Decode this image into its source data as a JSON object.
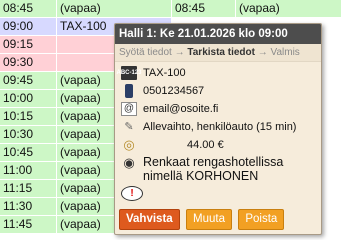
{
  "schedule": {
    "left_rows": [
      {
        "time": "08:45",
        "label": "(vapaa)",
        "status": "free"
      },
      {
        "time": "09:00",
        "label": "TAX-100",
        "status": "booked"
      },
      {
        "time": "09:15",
        "label": "",
        "status": "empty"
      },
      {
        "time": "09:30",
        "label": "",
        "status": "empty"
      },
      {
        "time": "09:45",
        "label": "(vapaa)",
        "status": "free"
      },
      {
        "time": "10:00",
        "label": "(vapaa)",
        "status": "free"
      },
      {
        "time": "10:15",
        "label": "(vapaa)",
        "status": "free"
      },
      {
        "time": "10:30",
        "label": "(vapaa)",
        "status": "free"
      },
      {
        "time": "10:45",
        "label": "(vapaa)",
        "status": "free"
      },
      {
        "time": "11:00",
        "label": "(vapaa)",
        "status": "free"
      },
      {
        "time": "11:15",
        "label": "(vapaa)",
        "status": "free"
      },
      {
        "time": "11:30",
        "label": "(vapaa)",
        "status": "free"
      },
      {
        "time": "11:45",
        "label": "(vapaa)",
        "status": "free"
      }
    ],
    "right_top": {
      "time": "08:45",
      "label": "(vapaa)",
      "status": "free"
    }
  },
  "popup": {
    "title": "Halli 1: Ke 21.01.2026 klo 09:00",
    "steps": {
      "step1": "Syötä tiedot",
      "arrow1": "→",
      "step2": "Tarkista tiedot",
      "arrow2": "→",
      "step3": "Valmis"
    },
    "registration": "TAX-100",
    "registration_icon": "ABC-123",
    "phone": "0501234567",
    "email": "email@osoite.fi",
    "service": "Allevaihto, henkilöauto (15 min)",
    "price": "44.00 €",
    "note": "Renkaat rengashotellissa nimellä KORHONEN",
    "bubble_symbol": "!",
    "buttons": {
      "confirm": "Vahvista",
      "modify": "Muuta",
      "delete": "Poista"
    }
  },
  "colors": {
    "free": "#cdf7c6",
    "booked": "#d7d9ff",
    "empty": "#ffd0d6",
    "primary_button": "#de5a1e",
    "secondary_button": "#f2a023",
    "title_bar": "#4d4d4d"
  },
  "icons": {
    "registration": "license-plate-icon",
    "phone": "mobile-phone-icon",
    "email": "at-sign-icon",
    "service": "tools-icon",
    "price": "coins-icon",
    "note": "tyre-icon",
    "comment": "speech-bubble-icon"
  }
}
